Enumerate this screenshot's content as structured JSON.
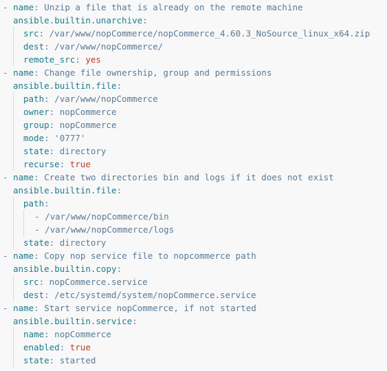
{
  "editor": {
    "lines": [
      {
        "indent": 0,
        "dash": "- ",
        "key": "name",
        "value": "Unzip a file that is already on the remote machine"
      },
      {
        "indent": 1,
        "key": "ansible.builtin.unarchive",
        "value": ""
      },
      {
        "indent": 2,
        "key": "src",
        "value": "/var/www/nopCommerce/nopCommerce_4.60.3_NoSource_linux_x64.zip"
      },
      {
        "indent": 2,
        "key": "dest",
        "value": "/var/www/nopCommerce/"
      },
      {
        "indent": 2,
        "key": "remote_src",
        "value": "yes",
        "bool": true
      },
      {
        "indent": 0,
        "dash": "- ",
        "key": "name",
        "value": "Change file ownership, group and permissions"
      },
      {
        "indent": 1,
        "key": "ansible.builtin.file",
        "value": ""
      },
      {
        "indent": 2,
        "key": "path",
        "value": "/var/www/nopCommerce"
      },
      {
        "indent": 2,
        "key": "owner",
        "value": "nopCommerce"
      },
      {
        "indent": 2,
        "key": "group",
        "value": "nopCommerce"
      },
      {
        "indent": 2,
        "key": "mode",
        "value": "'0777'"
      },
      {
        "indent": 2,
        "key": "state",
        "value": "directory"
      },
      {
        "indent": 2,
        "key": "recurse",
        "value": "true",
        "bool": true
      },
      {
        "indent": 0,
        "dash": "- ",
        "key": "name",
        "value": "Create two directories bin and logs if it does not exist"
      },
      {
        "indent": 1,
        "key": "ansible.builtin.file",
        "value": ""
      },
      {
        "indent": 2,
        "key": "path",
        "value": ""
      },
      {
        "indent": 3,
        "dash": "- ",
        "key": "",
        "value": "/var/www/nopCommerce/bin"
      },
      {
        "indent": 3,
        "dash": "- ",
        "key": "",
        "value": "/var/www/nopCommerce/logs"
      },
      {
        "indent": 2,
        "key": "state",
        "value": "directory"
      },
      {
        "indent": 0,
        "dash": "- ",
        "key": "name",
        "value": "Copy nop service file to nopcommerce path"
      },
      {
        "indent": 1,
        "key": "ansible.builtin.copy",
        "value": ""
      },
      {
        "indent": 2,
        "key": "src",
        "value": "nopCommerce.service"
      },
      {
        "indent": 2,
        "key": "dest",
        "value": "/etc/systemd/system/nopCommerce.service"
      },
      {
        "indent": 0,
        "dash": "- ",
        "key": "name",
        "value": "Start service nopCommerce, if not started"
      },
      {
        "indent": 1,
        "key": "ansible.builtin.service",
        "value": ""
      },
      {
        "indent": 2,
        "key": "name",
        "value": "nopCommerce"
      },
      {
        "indent": 2,
        "key": "enabled",
        "value": "true",
        "bool": true
      },
      {
        "indent": 2,
        "key": "state",
        "value": "started"
      }
    ]
  },
  "colors": {
    "background": "#f8f8f8",
    "key": "#1c7c8c",
    "value": "#5a7a96",
    "boolean": "#c0392b",
    "indent_guide": "#dadada"
  }
}
